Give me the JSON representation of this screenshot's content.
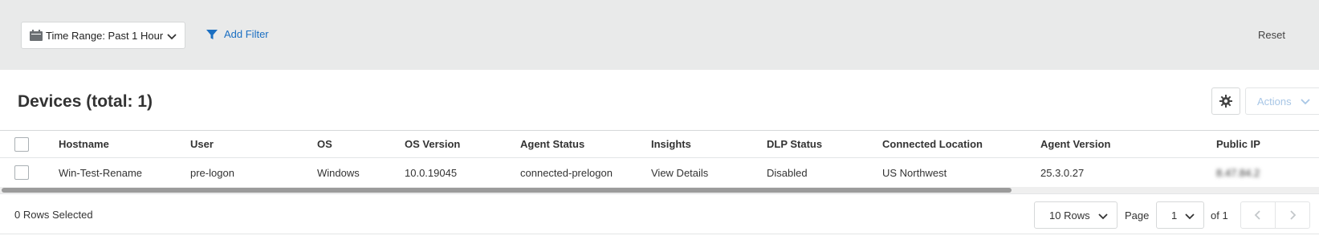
{
  "filter_bar": {
    "time_range_label": "Time Range: Past 1 Hour",
    "add_filter_label": "Add Filter",
    "reset_label": "Reset"
  },
  "header": {
    "title": "Devices (total: 1)",
    "actions_label": "Actions"
  },
  "table": {
    "columns": [
      "Hostname",
      "User",
      "OS",
      "OS Version",
      "Agent Status",
      "Insights",
      "DLP Status",
      "Connected Location",
      "Agent Version",
      "Public IP"
    ],
    "rows": [
      {
        "hostname": "Win-Test-Rename",
        "user": "pre-logon",
        "os": "Windows",
        "os_version": "10.0.19045",
        "agent_status": "connected-prelogon",
        "insights": "View Details",
        "dlp_status": "Disabled",
        "connected_location": "US Northwest",
        "agent_version": "25.3.0.27",
        "public_ip": "8.47.84.2"
      }
    ]
  },
  "footer": {
    "rows_selected": "0 Rows Selected",
    "rows_per_page": "10 Rows",
    "page_label": "Page",
    "current_page": "1",
    "of_label": "of 1"
  },
  "colors": {
    "link": "#1b6fc2",
    "filter_bar_bg": "#e9eaea",
    "disabled_action": "#a8c6e6"
  }
}
